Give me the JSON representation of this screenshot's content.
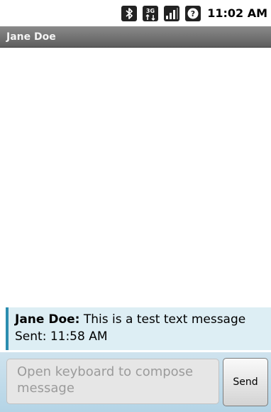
{
  "status_bar": {
    "icons": [
      "bluetooth-icon",
      "3g-data-icon",
      "signal-strength-icon",
      "alert-icon"
    ],
    "time": "11:02 AM"
  },
  "title_bar": {
    "title": "Jane Doe"
  },
  "messages": [
    {
      "sender": "Jane Doe:",
      "text": "This is a test text message",
      "sent": "Sent: 11:58 AM"
    }
  ],
  "compose": {
    "placeholder": "Open keyboard to compose message",
    "send_label": "Send"
  },
  "colors": {
    "accent": "#2b8db0",
    "message_background": "#ddeef4",
    "title_bar": "#6e6e6e"
  }
}
